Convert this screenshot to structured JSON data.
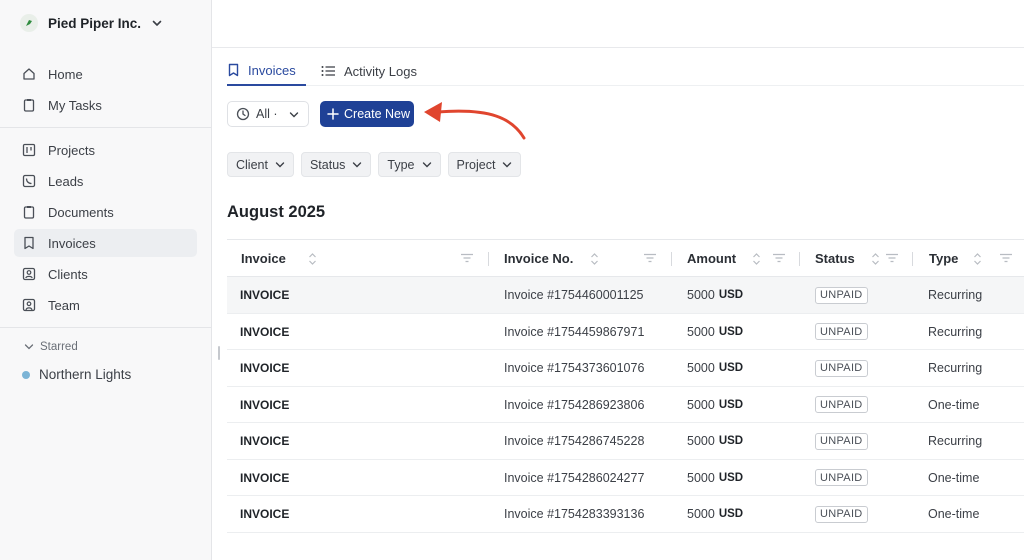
{
  "sidebar": {
    "org_name": "Pied Piper Inc.",
    "primary": [
      {
        "label": "Home",
        "icon": "home-icon"
      },
      {
        "label": "My Tasks",
        "icon": "clipboard-icon"
      }
    ],
    "secondary": [
      {
        "label": "Projects",
        "icon": "kanban-icon"
      },
      {
        "label": "Leads",
        "icon": "phone-icon"
      },
      {
        "label": "Documents",
        "icon": "clipboard-icon"
      },
      {
        "label": "Invoices",
        "icon": "bookmark-icon",
        "active": true
      },
      {
        "label": "Clients",
        "icon": "clients-icon"
      },
      {
        "label": "Team",
        "icon": "team-icon"
      }
    ],
    "starred_label": "Starred",
    "starred": [
      {
        "label": "Northern Lights",
        "color": "#7cb4d6"
      }
    ]
  },
  "tabs": [
    {
      "label": "Invoices",
      "icon": "bookmark-icon",
      "active": true
    },
    {
      "label": "Activity Logs",
      "icon": "list-icon",
      "active": false
    }
  ],
  "toolbar": {
    "period_label": "All ·",
    "create_label": "Create New"
  },
  "filters": [
    "Client",
    "Status",
    "Type",
    "Project"
  ],
  "section_title": "August 2025",
  "table": {
    "columns": [
      "Invoice",
      "Invoice No.",
      "Amount",
      "Status",
      "Type"
    ],
    "rows": [
      {
        "invoice": "INVOICE",
        "number": "Invoice #1754460001125",
        "amount": "5000",
        "currency": "USD",
        "status": "UNPAID",
        "type": "Recurring"
      },
      {
        "invoice": "INVOICE",
        "number": "Invoice #1754459867971",
        "amount": "5000",
        "currency": "USD",
        "status": "UNPAID",
        "type": "Recurring"
      },
      {
        "invoice": "INVOICE",
        "number": "Invoice #1754373601076",
        "amount": "5000",
        "currency": "USD",
        "status": "UNPAID",
        "type": "Recurring"
      },
      {
        "invoice": "INVOICE",
        "number": "Invoice #1754286923806",
        "amount": "5000",
        "currency": "USD",
        "status": "UNPAID",
        "type": "One-time"
      },
      {
        "invoice": "INVOICE",
        "number": "Invoice #1754286745228",
        "amount": "5000",
        "currency": "USD",
        "status": "UNPAID",
        "type": "Recurring"
      },
      {
        "invoice": "INVOICE",
        "number": "Invoice #1754286024277",
        "amount": "5000",
        "currency": "USD",
        "status": "UNPAID",
        "type": "One-time"
      },
      {
        "invoice": "INVOICE",
        "number": "Invoice #1754283393136",
        "amount": "5000",
        "currency": "USD",
        "status": "UNPAID",
        "type": "One-time"
      }
    ]
  },
  "colors": {
    "accent": "#1f4196",
    "annotation_arrow": "#e0452e"
  }
}
